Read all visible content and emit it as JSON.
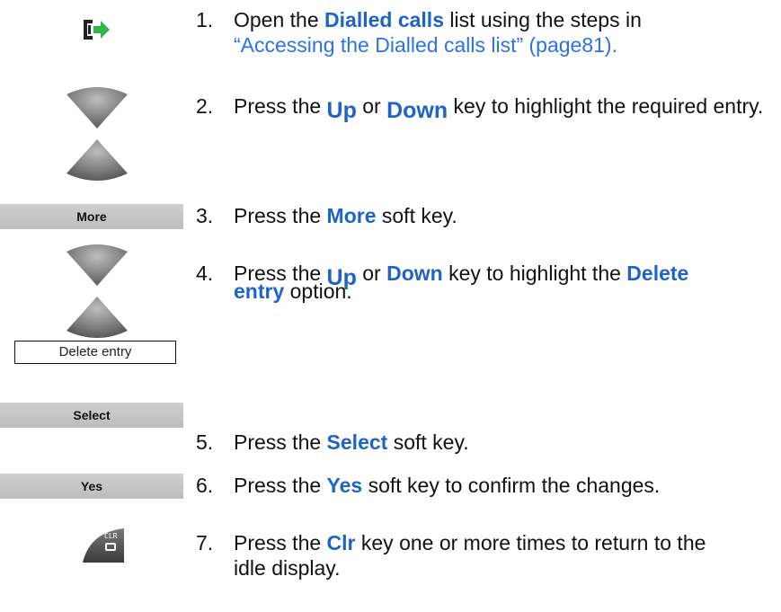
{
  "steps": [
    {
      "number": "1.",
      "parts": [
        "Open the ",
        "Dialled calls",
        " list using the steps in"
      ],
      "link_text": "“Accessing the Dialled calls list” (page81)."
    },
    {
      "number": "2.",
      "parts": [
        "Press the ",
        "Up",
        " or ",
        "Down",
        " key to highlight the required entry."
      ]
    },
    {
      "number": "3.",
      "parts": [
        "Press the ",
        "More",
        " soft key."
      ]
    },
    {
      "number": "4.",
      "parts": [
        "Press the ",
        "Up",
        " or ",
        "Down",
        " key to highlight the ",
        "Delete",
        "entry",
        " option."
      ]
    },
    {
      "number": "5.",
      "parts": [
        "Press the ",
        "Select",
        " soft key."
      ]
    },
    {
      "number": "6.",
      "parts": [
        "Press the ",
        "Yes",
        " soft key to confirm the changes."
      ]
    },
    {
      "number": "7.",
      "parts": [
        "Press the ",
        "Clr",
        " key one or more times to return to the",
        "idle display."
      ]
    }
  ],
  "softkeys": {
    "more": "More",
    "select": "Select",
    "yes": "Yes"
  },
  "menu_option": "Delete entry",
  "clr_key": {
    "top": "CLR"
  },
  "icons": {
    "step1": "dialled-calls-icon",
    "step2": "up-down-navigation-key-icon",
    "step4": "up-down-navigation-key-icon",
    "step7": "clr-key-icon"
  },
  "colors": {
    "keyword": "#1e64c8",
    "link": "#2a73e8",
    "softkey_bg": "#c6c6c6",
    "icon_green": "#2db84a"
  }
}
